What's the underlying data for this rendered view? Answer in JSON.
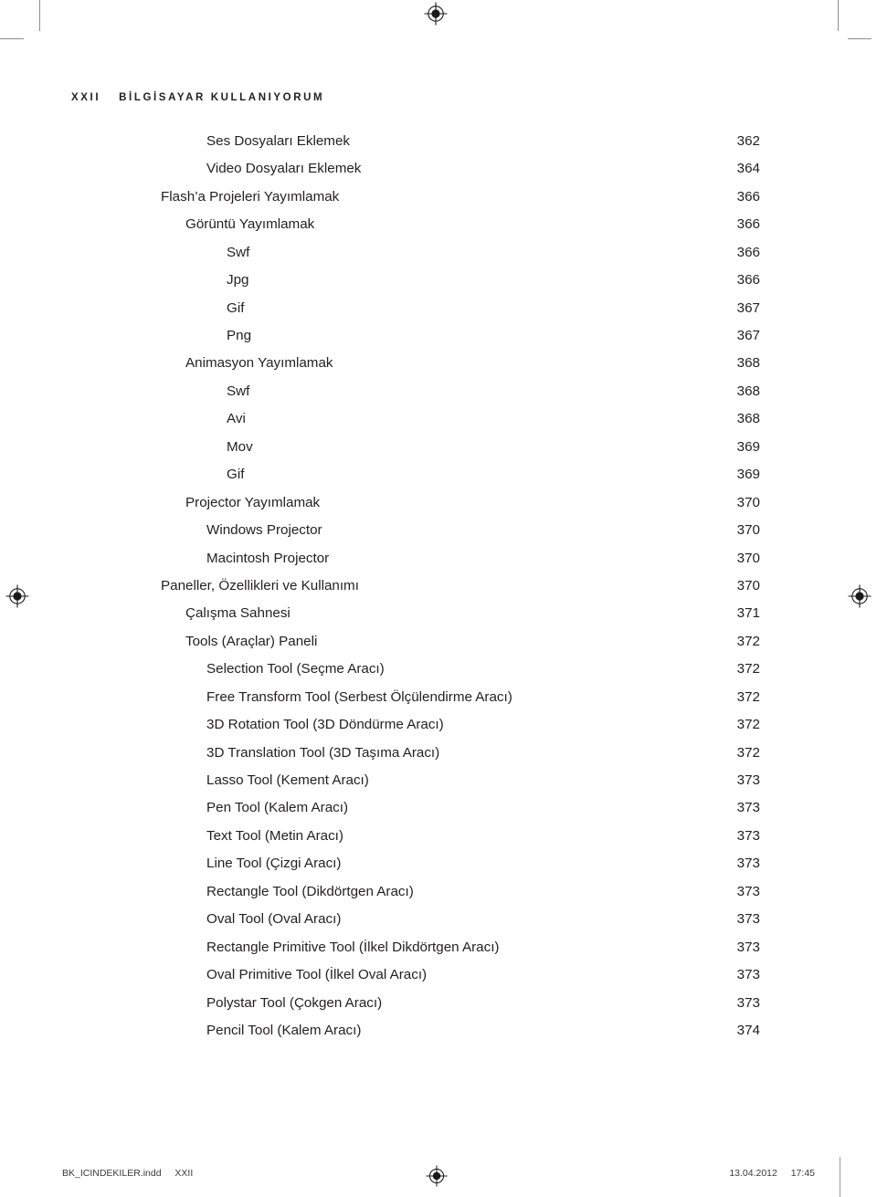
{
  "page": {
    "folio": "XXII",
    "running_head": "BİLGİSAYAR KULLANIYORUM"
  },
  "toc": {
    "entries": [
      {
        "title": "Ses Dosyaları Eklemek",
        "page": "362",
        "level": 2
      },
      {
        "title": "Video Dosyaları Eklemek",
        "page": "364",
        "level": 2
      },
      {
        "title": "Flash’a Projeleri Yayımlamak",
        "page": "366",
        "level": 0
      },
      {
        "title": "Görüntü Yayımlamak",
        "page": "366",
        "level": 1
      },
      {
        "title": "Swf",
        "page": "366",
        "level": 3
      },
      {
        "title": "Jpg",
        "page": "366",
        "level": 3
      },
      {
        "title": "Gif",
        "page": "367",
        "level": 3
      },
      {
        "title": "Png",
        "page": "367",
        "level": 3
      },
      {
        "title": "Animasyon Yayımlamak",
        "page": "368",
        "level": 1
      },
      {
        "title": "Swf",
        "page": "368",
        "level": 3
      },
      {
        "title": "Avi",
        "page": "368",
        "level": 3
      },
      {
        "title": "Mov",
        "page": "369",
        "level": 3
      },
      {
        "title": "Gif",
        "page": "369",
        "level": 3
      },
      {
        "title": "Projector Yayımlamak",
        "page": "370",
        "level": 1
      },
      {
        "title": "Windows Projector",
        "page": "370",
        "level": 2
      },
      {
        "title": "Macintosh Projector",
        "page": "370",
        "level": 2
      },
      {
        "title": "Paneller, Özellikleri ve Kullanımı",
        "page": "370",
        "level": 0
      },
      {
        "title": "Çalışma Sahnesi",
        "page": "371",
        "level": 1
      },
      {
        "title": "Tools (Araçlar) Paneli",
        "page": "372",
        "level": 1
      },
      {
        "title": "Selection Tool (Seçme Aracı)",
        "page": "372",
        "level": 2
      },
      {
        "title": "Free Transform Tool (Serbest Ölçülendirme Aracı)",
        "page": "372",
        "level": 2
      },
      {
        "title": "3D Rotation Tool (3D Döndürme Aracı)",
        "page": "372",
        "level": 2
      },
      {
        "title": "3D Translation Tool (3D Taşıma Aracı)",
        "page": "372",
        "level": 2
      },
      {
        "title": "Lasso Tool (Kement Aracı)",
        "page": "373",
        "level": 2
      },
      {
        "title": "Pen Tool (Kalem Aracı)",
        "page": "373",
        "level": 2
      },
      {
        "title": "Text Tool (Metin Aracı)",
        "page": "373",
        "level": 2
      },
      {
        "title": "Line Tool (Çizgi Aracı)",
        "page": "373",
        "level": 2
      },
      {
        "title": "Rectangle Tool (Dikdörtgen Aracı)",
        "page": "373",
        "level": 2
      },
      {
        "title": "Oval Tool (Oval Aracı)",
        "page": "373",
        "level": 2
      },
      {
        "title": "Rectangle Primitive Tool (İlkel Dikdörtgen Aracı)",
        "page": "373",
        "level": 2
      },
      {
        "title": "Oval Primitive Tool (İlkel Oval Aracı)",
        "page": "373",
        "level": 2
      },
      {
        "title": "Polystar Tool (Çokgen Aracı)",
        "page": "373",
        "level": 2
      },
      {
        "title": "Pencil Tool (Kalem Aracı)",
        "page": "374",
        "level": 2
      }
    ]
  },
  "footer": {
    "filename": "BK_ICINDEKILER.indd",
    "folio": "XXII",
    "date": "13.04.2012",
    "time": "17:45"
  },
  "colors": {
    "text": "#231f20",
    "crop_mark": "#8d8d8d",
    "footer_text": "#3a3a3a"
  }
}
